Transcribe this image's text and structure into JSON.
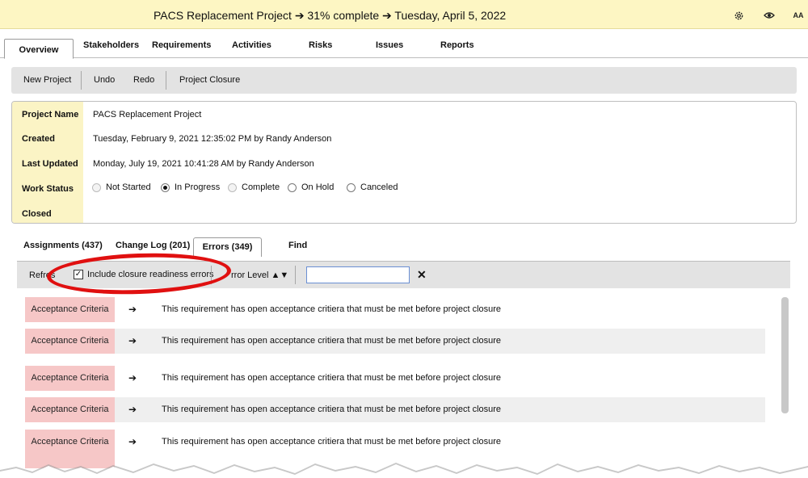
{
  "header": {
    "title": "PACS Replacement Project ➔ 31% complete ➔ Tuesday, April 5, 2022",
    "icons": [
      "settings-icon",
      "eye-icon",
      "font-size-icon"
    ],
    "font_icon_label": "AA"
  },
  "tabs": [
    {
      "label": "Overview"
    },
    {
      "label": "Stakeholders"
    },
    {
      "label": "Requirements"
    },
    {
      "label": "Activities"
    },
    {
      "label": "Risks"
    },
    {
      "label": "Issues"
    },
    {
      "label": "Reports"
    }
  ],
  "toolbar": {
    "new_project": "New Project",
    "undo": "Undo",
    "redo": "Redo",
    "project_closure": "Project Closure"
  },
  "info": {
    "project_name_label": "Project Name",
    "project_name": "PACS Replacement Project",
    "created_label": "Created",
    "created": "Tuesday, February 9, 2021 12:35:02 PM by Randy Anderson",
    "last_updated_label": "Last Updated",
    "last_updated": "Monday, July 19, 2021 10:41:28 AM by Randy Anderson",
    "work_status_label": "Work Status",
    "closed_label": "Closed",
    "work_status_options": [
      "Not Started",
      "In Progress",
      "Complete",
      "On Hold",
      "Canceled"
    ],
    "work_status_selected": "In Progress"
  },
  "subtabs": [
    {
      "label": "Assignments  (437)"
    },
    {
      "label": "Change Log  (201)"
    },
    {
      "label": "Errors  (349)"
    },
    {
      "label": "Find"
    }
  ],
  "errors_toolbar": {
    "refresh_partial": "Refres",
    "include_closure": "Include closure readiness errors",
    "include_closure_checked": true,
    "error_level_partial": "rror Level ▲▼",
    "search_value": "",
    "clear_glyph": "✕"
  },
  "error_rows": [
    {
      "type": "Acceptance Criteria",
      "arrow": "➔",
      "message": "This requirement has open acceptance critiera that must be met before project closure"
    },
    {
      "type": "Acceptance Criteria",
      "arrow": "➔",
      "message": "This requirement has open acceptance critiera that must be met before project closure"
    },
    {
      "type": "Acceptance Criteria",
      "arrow": "➔",
      "message": "This requirement has open acceptance critiera that must be met before project closure"
    },
    {
      "type": "Acceptance Criteria",
      "arrow": "➔",
      "message": "This requirement has open acceptance critiera that must be met before project closure"
    },
    {
      "type": "Acceptance Criteria",
      "arrow": "➔",
      "message": "This requirement has open acceptance critiera that must be met before project closure"
    }
  ],
  "colors": {
    "title_bar": "#fdf6c3",
    "label_column": "#fbf4c5",
    "error_badge": "#f6c7c7",
    "annotation_circle": "#e01010"
  }
}
